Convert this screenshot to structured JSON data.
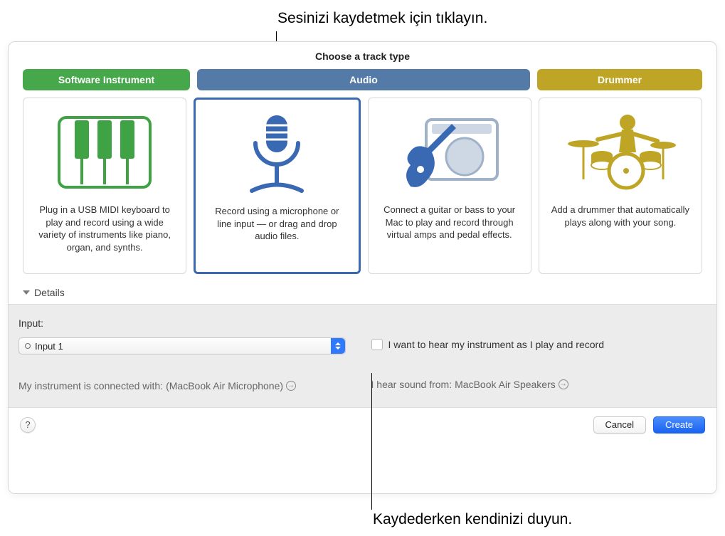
{
  "callouts": {
    "top": "Sesinizi kaydetmek için tıklayın.",
    "bottom": "Kaydederken kendinizi duyun."
  },
  "dialog": {
    "title": "Choose a track type",
    "tabs": {
      "software": "Software Instrument",
      "audio": "Audio",
      "drummer": "Drummer"
    },
    "cards": {
      "software_desc": "Plug in a USB MIDI keyboard to play and record using a wide variety of instruments like piano, organ, and synths.",
      "mic_desc": "Record using a microphone or line input — or drag and drop audio files.",
      "guitar_desc": "Connect a guitar or bass to your Mac to play and record through virtual amps and pedal effects.",
      "drummer_desc": "Add a drummer that automatically plays along with your song."
    },
    "details": {
      "header": "Details",
      "input_label": "Input:",
      "input_value": "Input 1",
      "connected_prefix": "My instrument is connected with:",
      "connected_device": "(MacBook Air Microphone)",
      "monitor_label": "I want to hear my instrument as I play and record",
      "hear_prefix": "I hear sound from:",
      "hear_device": "MacBook Air Speakers"
    },
    "footer": {
      "help": "?",
      "cancel": "Cancel",
      "create": "Create"
    }
  }
}
